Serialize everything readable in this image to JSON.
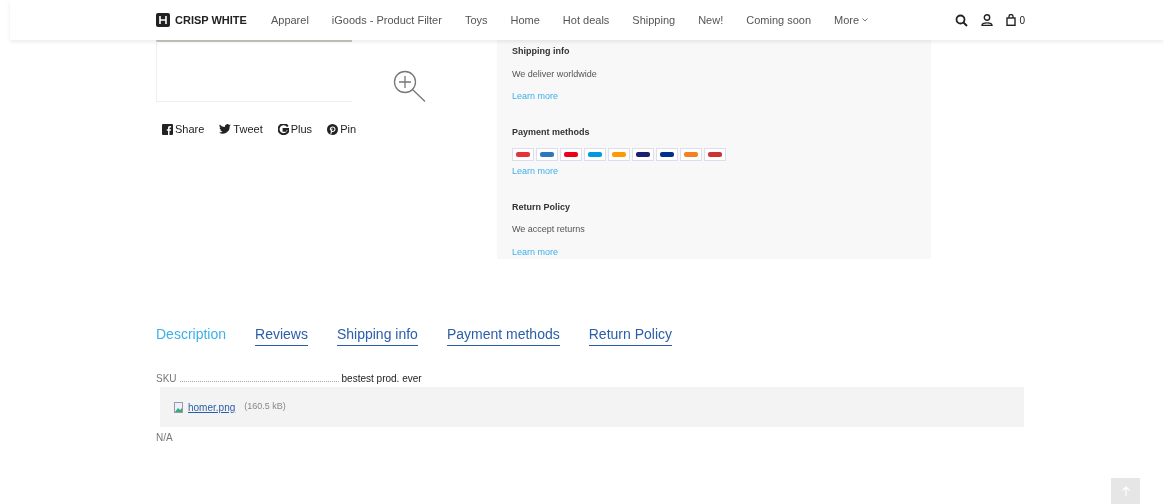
{
  "header": {
    "logo_text": "CRISP WHITE",
    "nav": [
      "Apparel",
      "iGoods - Product Filter",
      "Toys",
      "Home",
      "Hot deals",
      "Shipping",
      "New!",
      "Coming soon",
      "More"
    ],
    "cart_count": "0"
  },
  "share": [
    "Share",
    "Tweet",
    "Plus",
    "Pin"
  ],
  "info_panel": [
    {
      "title": "Shipping info",
      "text": "We deliver worldwide",
      "link": "Learn more"
    },
    {
      "title": "Payment methods",
      "payment_logos": true,
      "link": "Learn more"
    },
    {
      "title": "Return Policy",
      "text": "We accept returns",
      "link": "Learn more"
    }
  ],
  "tabs": [
    {
      "label": "Description",
      "selected": true
    },
    {
      "label": "Reviews",
      "selected": false
    },
    {
      "label": "Shipping info",
      "selected": false
    },
    {
      "label": "Payment methods",
      "selected": false
    },
    {
      "label": "Return Policy",
      "selected": false
    }
  ],
  "sku": {
    "label": "SKU",
    "value": "bestest prod. ever"
  },
  "attachment": {
    "name": "homer.png",
    "size": "(160.5 kB)"
  },
  "note": "N/A"
}
